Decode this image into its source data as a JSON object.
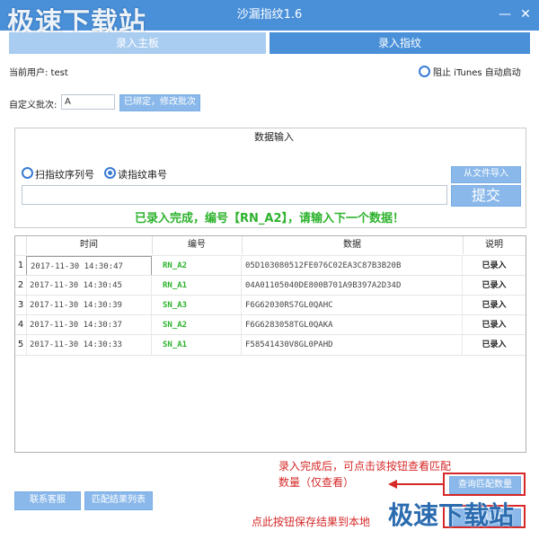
{
  "window": {
    "title": "沙漏指纹1.6",
    "minimize": "—",
    "close": "✕",
    "watermark": "极速下载站"
  },
  "tabs": [
    {
      "label": "录入主板"
    },
    {
      "label": "录入指纹"
    }
  ],
  "user": {
    "label": "当前用户: test",
    "block_itunes": "阻止 iTunes 自动启动"
  },
  "batch": {
    "label": "自定义批次:",
    "value": "A",
    "button": "已绑定，修改批次"
  },
  "data_input": {
    "title": "数据输入",
    "radio_scan": "扫指纹序列号",
    "radio_read": "读指纹串号",
    "import_button": "从文件导入",
    "submit_button": "提交",
    "input_value": "",
    "status": "已录入完成，编号【RN_A2】，请输入下一个数据！"
  },
  "table": {
    "headers": [
      "时间",
      "编号",
      "数据",
      "说明"
    ],
    "rows": [
      {
        "n": "1",
        "time": "2017-11-30 14:30:47",
        "code": "RN_A2",
        "data": "05D103080512FE076C02EA3C87B3B20B",
        "state": "已录入"
      },
      {
        "n": "2",
        "time": "2017-11-30 14:30:45",
        "code": "RN_A1",
        "data": "04A01105040DE800B701A9B397A2D34D",
        "state": "已录入"
      },
      {
        "n": "3",
        "time": "2017-11-30 14:30:39",
        "code": "SN_A3",
        "data": "F6G62030RS7GL0QAHC",
        "state": "已录入"
      },
      {
        "n": "4",
        "time": "2017-11-30 14:30:37",
        "code": "SN_A2",
        "data": "F6G6283058TGL0QAKA",
        "state": "已录入"
      },
      {
        "n": "5",
        "time": "2017-11-30 14:30:33",
        "code": "SN_A1",
        "data": "F58541430V8GL0PAHD",
        "state": "已录入"
      }
    ]
  },
  "footer": {
    "contact_button": "联系客服",
    "match_list_button": "匹配结果列表",
    "query_match_button": "查询匹配数量",
    "annotation1_line1": "录入完成后，可点击该按钮查看匹配",
    "annotation1_line2": "数量（仅查看）",
    "annotation2": "点此按钮保存结果到本地",
    "save_button": "输出结果"
  },
  "colors": {
    "accent": "#4a90d9",
    "button": "#8ab8ea",
    "success": "#2db32d",
    "annotation": "#d62828"
  }
}
